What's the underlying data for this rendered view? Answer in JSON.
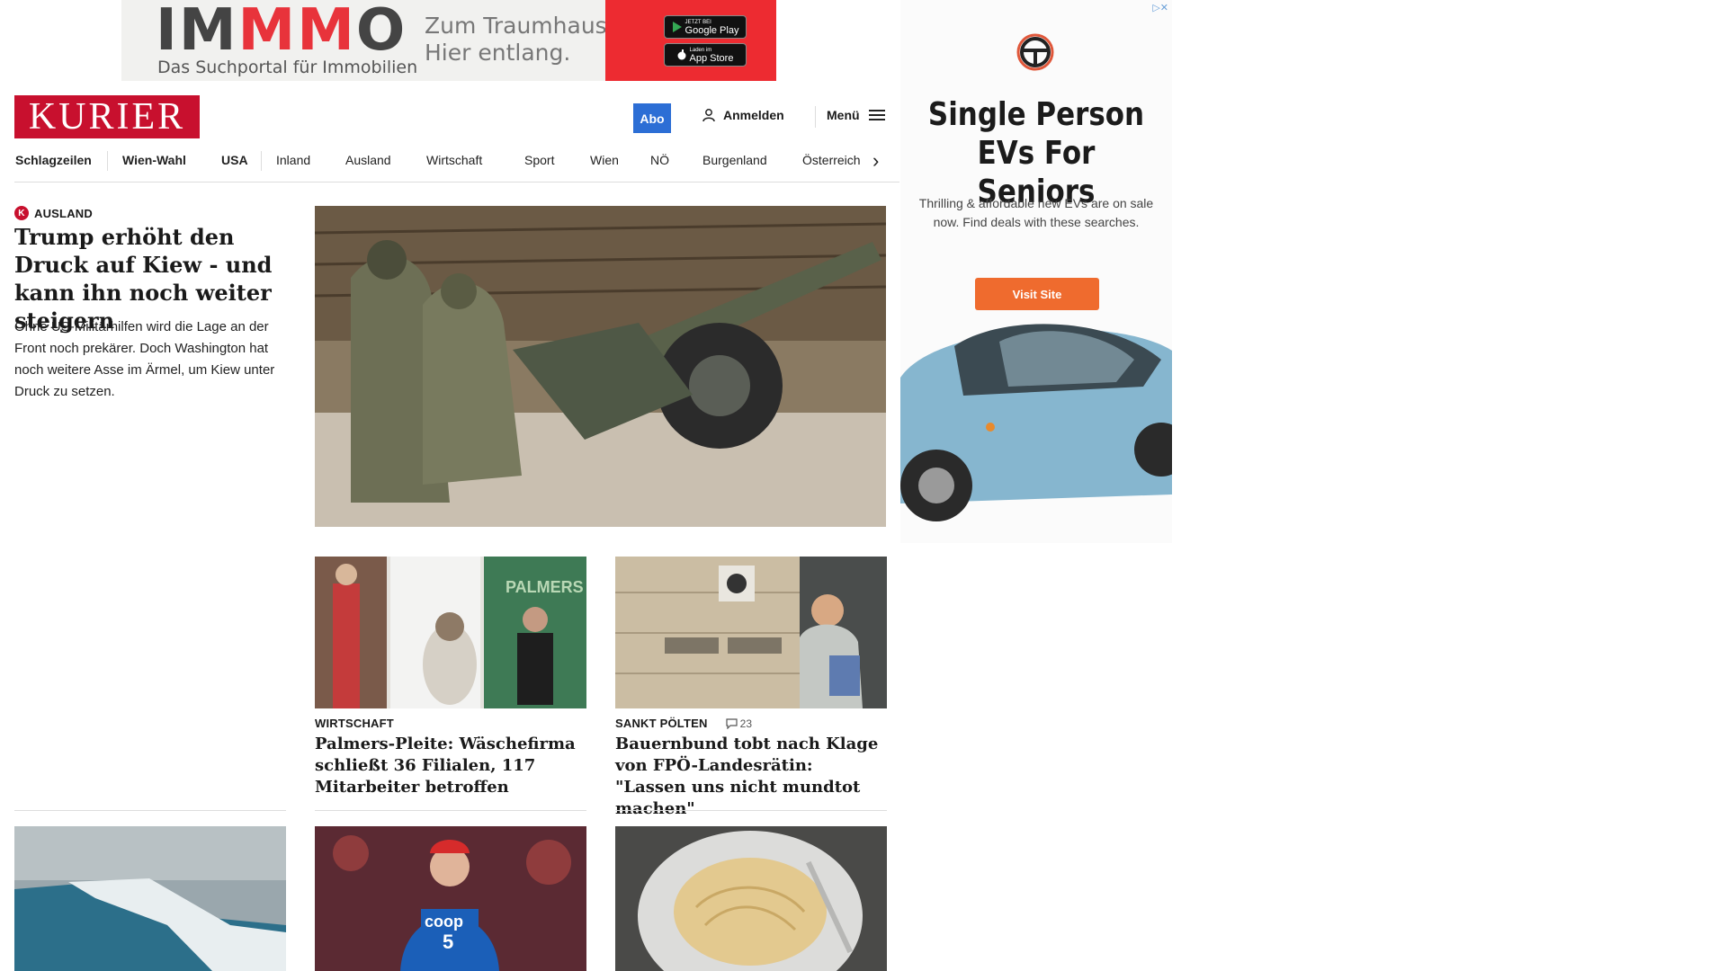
{
  "top_ad": {
    "brand_part1": "IM",
    "brand_part2": "MM",
    "brand_part3": "O",
    "tagline": "Das Suchportal für Immobilien",
    "slogan_line1": "Zum Traumhaus?",
    "slogan_line2": "Hier entlang.",
    "google_play_small": "JETZT BEI",
    "google_play": "Google Play",
    "app_store_small": "Laden im",
    "app_store": "App Store"
  },
  "header": {
    "logo": "KURIER",
    "abo": "Abo",
    "login": "Anmelden",
    "menu": "Menü"
  },
  "nav": {
    "items": [
      "Schlagzeilen",
      "Wien-Wahl",
      "USA",
      "Inland",
      "Ausland",
      "Wirtschaft",
      "Sport",
      "Wien",
      "NÖ",
      "Burgenland",
      "Österreich"
    ]
  },
  "lead": {
    "kicker": "AUSLAND",
    "title": "Trump erhöht den Druck auf Kiew - und kann ihn noch weiter steigern",
    "teaser": "Ohne US-Militärhilfen wird die Lage an der Front noch prekärer. Doch Washington hat noch weitere Asse im Ärmel, um Kiew unter Druck zu setzen."
  },
  "articles": [
    {
      "kicker": "WIRTSCHAFT",
      "title": "Palmers-Pleite: Wäschefirma schließt 36 Filialen, 117 Mitarbeiter betroffen",
      "store_sign": "PALMERS"
    },
    {
      "kicker": "SANKT PÖLTEN",
      "comments": "23",
      "title": "Bauernbund tobt nach Klage von FPÖ-Landesrätin: \"Lassen uns nicht mundtot machen\""
    }
  ],
  "bottom_row": {
    "bib_text": "coop",
    "bib_number": "5"
  },
  "side_ad": {
    "title": "Single Person EVs For Seniors",
    "desc": "Thrilling & affordable new EVs are on sale now. Find deals with these searches.",
    "cta": "Visit Site"
  },
  "colors": {
    "brand_red": "#c8102e",
    "abo_blue": "#2c6ed5",
    "ad_orange": "#ef6b2e",
    "immmo_red": "#ed2b31"
  }
}
